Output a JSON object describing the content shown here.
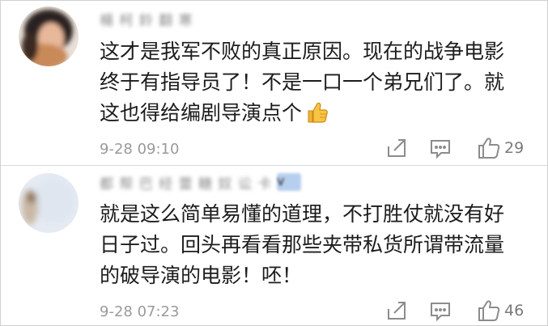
{
  "comments": [
    {
      "username": "楊 柯 鈴 翻 寒",
      "text_lines": [
        "这才是我军不败的真正原因。现在的战争电影",
        "终于有指导员了！不是一口一个弟兄们了。就",
        "这也得给编剧导演点个"
      ],
      "emoji": "thumbs-up-icon",
      "time": "9-28 09:10",
      "likes": "29"
    },
    {
      "username": "都 帮 巴 经 蕾 糖 奴 讼 卡",
      "verified_badge": "v",
      "text_lines": [
        "就是这么简单易懂的道理，不打胜仗就没有好",
        "日子过。回头再看看那些夹带私货所谓带流量",
        "的破导演的电影！呸！"
      ],
      "time": "9-28 07:23",
      "likes": "46"
    }
  ],
  "colors": {
    "text": "#1c1c1c",
    "meta": "#9a9a9a",
    "icon": "#8c8c8c",
    "divider": "#d8d8d8"
  }
}
